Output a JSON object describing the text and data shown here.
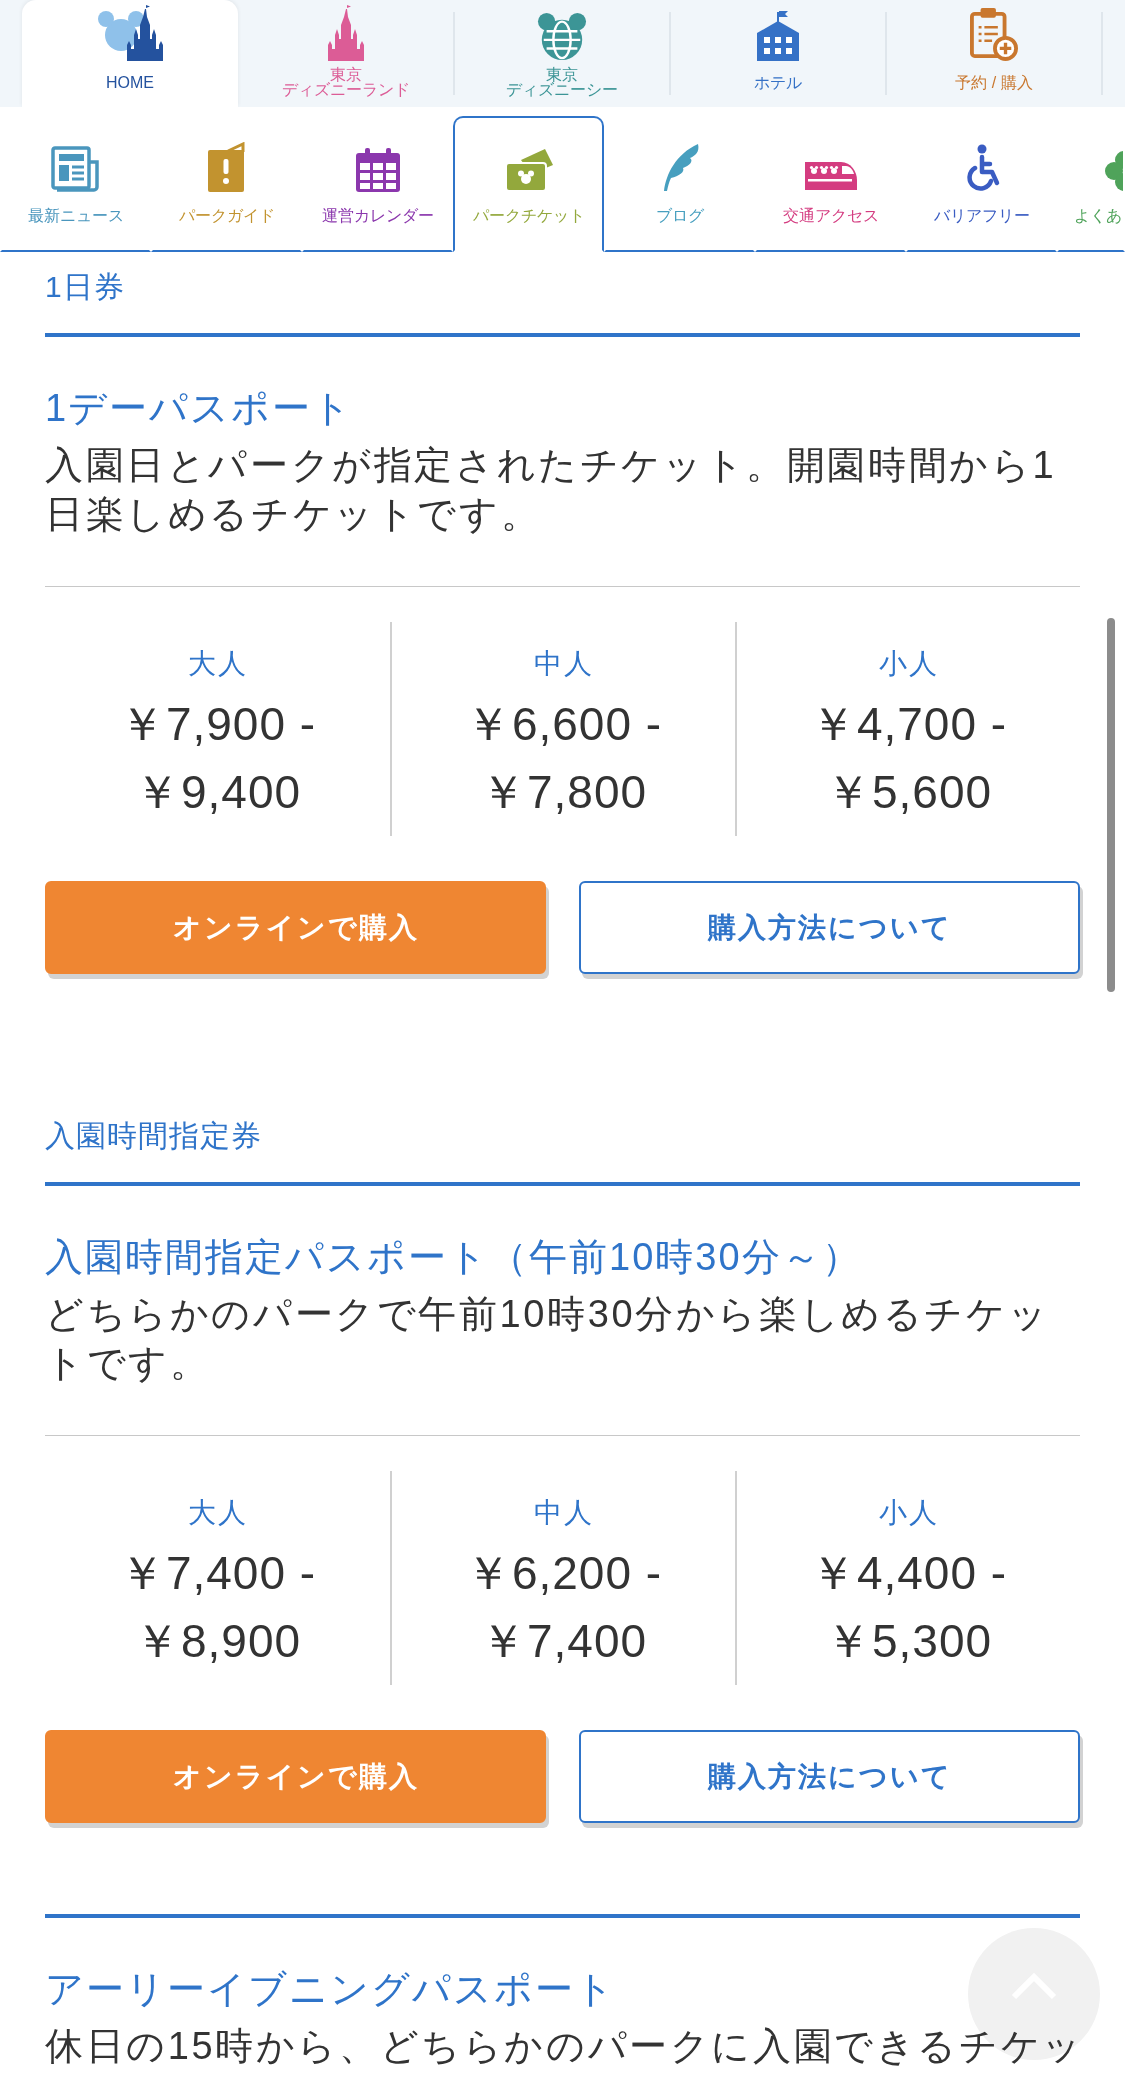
{
  "top_nav": {
    "tabs": [
      {
        "label_lines": [
          "HOME"
        ],
        "selected": true,
        "color": "#24529e"
      },
      {
        "label_lines": [
          "東京",
          "ディズニーランド"
        ],
        "selected": false,
        "color": "#dc5c96"
      },
      {
        "label_lines": [
          "東京",
          "ディズニーシー"
        ],
        "selected": false,
        "color": "#3c9596"
      },
      {
        "label_lines": [
          "ホテル"
        ],
        "selected": false,
        "color": "#3571c6"
      },
      {
        "label_lines": [
          "予約 / 購入"
        ],
        "selected": false,
        "color": "#c9772e"
      }
    ]
  },
  "sub_nav": {
    "items": [
      {
        "label": "最新ニュース",
        "selected": false,
        "color": "#4a96bd"
      },
      {
        "label": "パークガイド",
        "selected": false,
        "color": "#c2932f"
      },
      {
        "label": "運営カレンダー",
        "selected": false,
        "color": "#8b37ad"
      },
      {
        "label": "パークチケット",
        "selected": true,
        "color": "#93a83c"
      },
      {
        "label": "ブログ",
        "selected": false,
        "color": "#479fbf"
      },
      {
        "label": "交通アクセス",
        "selected": false,
        "color": "#d43c80"
      },
      {
        "label": "バリアフリー",
        "selected": false,
        "color": "#3a5cc2"
      },
      {
        "label": "よくあ",
        "selected": false,
        "color": "#4fa35a"
      }
    ]
  },
  "sections": [
    {
      "heading": "1日券",
      "tickets": [
        {
          "title": "1デーパスポート",
          "description": "入園日とパークが指定されたチケット。開園時間から1日楽しめるチケットです。",
          "prices": [
            {
              "label": "大人",
              "price": "￥7,900 - ￥9,400"
            },
            {
              "label": "中人",
              "price": "￥6,600 - ￥7,800"
            },
            {
              "label": "小人",
              "price": "￥4,700 - ￥5,600"
            }
          ],
          "buttons": [
            {
              "kind": "primary",
              "label": "オンラインで購入"
            },
            {
              "kind": "secondary",
              "label": "購入方法について"
            }
          ]
        }
      ]
    },
    {
      "heading": "入園時間指定券",
      "tickets": [
        {
          "title": "入園時間指定パスポート（午前10時30分～）",
          "description": "どちらかのパークで午前10時30分から楽しめるチケットです。",
          "prices": [
            {
              "label": "大人",
              "price": "￥7,400 - ￥8,900"
            },
            {
              "label": "中人",
              "price": "￥6,200 - ￥7,400"
            },
            {
              "label": "小人",
              "price": "￥4,400 - ￥5,300"
            }
          ],
          "buttons": [
            {
              "kind": "primary",
              "label": "オンラインで購入"
            },
            {
              "kind": "secondary",
              "label": "購入方法について"
            }
          ]
        },
        {
          "title": "アーリーイブニングパスポート",
          "description": "休日の15時から、どちらかのパークに入園できるチケッ"
        }
      ]
    }
  ]
}
